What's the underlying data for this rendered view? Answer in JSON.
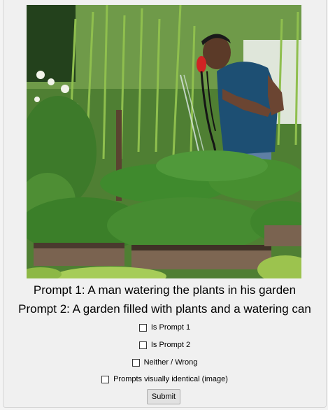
{
  "prompts": {
    "prompt1": "Prompt 1: A man watering the plants in his garden",
    "prompt2": "Prompt 2: A garden filled with plants and a watering can"
  },
  "options": {
    "is_prompt_1": "Is Prompt 1",
    "is_prompt_2": "Is Prompt 2",
    "neither": "Neither / Wrong",
    "identical": "Prompts visually identical (image)"
  },
  "actions": {
    "submit": "Submit"
  }
}
